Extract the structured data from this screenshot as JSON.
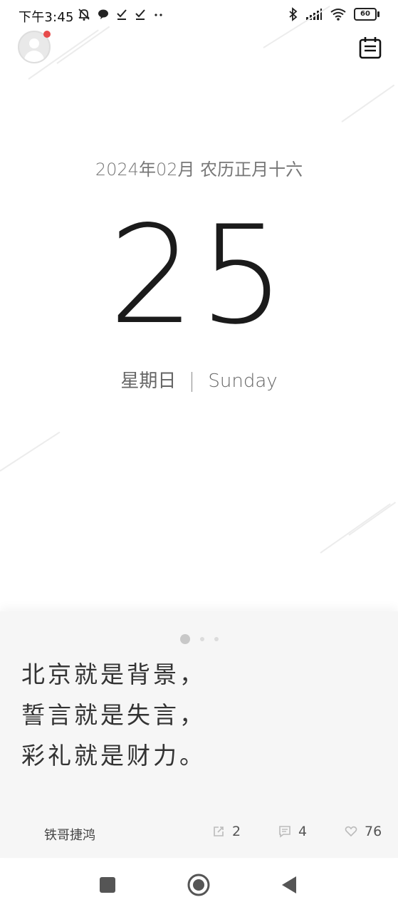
{
  "status_bar": {
    "time": "下午3:45",
    "battery": "60",
    "left_icons": [
      "bell-off-icon",
      "chat-bubble-icon",
      "check-icon",
      "check-icon",
      "more-dots-icon"
    ],
    "right_icons": [
      "bluetooth-icon",
      "signal-icon",
      "wifi-icon",
      "battery-icon"
    ]
  },
  "header": {
    "avatar_badge_color": "#e74b4b"
  },
  "date": {
    "year_month_lunar": "2024年02月 农历正月十六",
    "day": "25",
    "weekday_cn": "星期日",
    "weekday_en": "Sunday"
  },
  "quote_card": {
    "page_indicator": {
      "count": 3,
      "active": 0
    },
    "lines": [
      "北京就是背景，",
      "誓言就是失言，",
      "彩礼就是财力。"
    ],
    "author": "铁哥捷鸿",
    "share_count": "2",
    "comment_count": "4",
    "like_count": "76"
  },
  "nav": {
    "items": [
      "recent-apps-button",
      "home-button",
      "back-button"
    ]
  }
}
